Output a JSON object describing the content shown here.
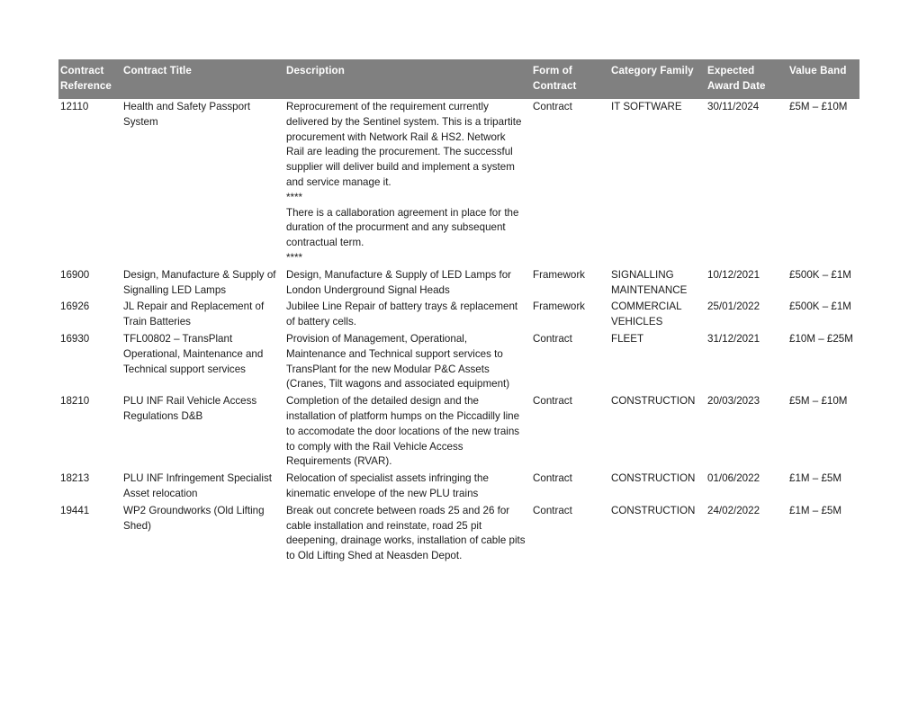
{
  "table": {
    "columns": [
      {
        "key": "contract_reference",
        "label": "Contract Reference"
      },
      {
        "key": "contract_title",
        "label": "Contract Title"
      },
      {
        "key": "description",
        "label": "Description"
      },
      {
        "key": "form_of_contract",
        "label": "Form of Contract"
      },
      {
        "key": "category_family",
        "label": "Category Family"
      },
      {
        "key": "expected_award_date",
        "label": "Expected Award Date"
      },
      {
        "key": "value_band",
        "label": "Value Band"
      }
    ],
    "header_background": "#808080",
    "header_text_color": "#ffffff",
    "rows": [
      {
        "contract_reference": "12110",
        "contract_title": "Health and Safety Passport System",
        "description": "Reprocurement of the requirement currently delivered by the Sentinel system. This is a tripartite procurement with Network Rail & HS2. Network Rail are leading the procurement. The successful supplier will deliver build and implement a system and service manage it.\n****\nThere is a callaboration agreement in place for the duration of the procurment and any subsequent contractual term.\n****",
        "form_of_contract": "Contract",
        "category_family": "IT SOFTWARE",
        "expected_award_date": "30/11/2024",
        "value_band": "£5M – £10M"
      },
      {
        "contract_reference": "16900",
        "contract_title": "Design, Manufacture & Supply of Signalling LED Lamps",
        "description": "Design, Manufacture & Supply of LED Lamps for London Underground Signal Heads",
        "form_of_contract": "Framework",
        "category_family": "SIGNALLING MAINTENANCE",
        "expected_award_date": "10/12/2021",
        "value_band": "£500K – £1M"
      },
      {
        "contract_reference": "16926",
        "contract_title": "JL Repair and Replacement of Train Batteries",
        "description": "Jubilee Line Repair of battery trays & replacement of battery cells.",
        "form_of_contract": "Framework",
        "category_family": "COMMERCIAL VEHICLES",
        "expected_award_date": "25/01/2022",
        "value_band": "£500K – £1M"
      },
      {
        "contract_reference": "16930",
        "contract_title": "TFL00802 – TransPlant Operational, Maintenance and Technical support services",
        "description": "Provision of Management, Operational, Maintenance and Technical support services to TransPlant for the new Modular P&C Assets (Cranes, Tilt wagons and associated equipment)",
        "form_of_contract": "Contract",
        "category_family": "FLEET",
        "expected_award_date": "31/12/2021",
        "value_band": "£10M – £25M"
      },
      {
        "contract_reference": "18210",
        "contract_title": "PLU INF Rail Vehicle Access Regulations D&B",
        "description": "Completion of the detailed design and the installation of platform humps on the Piccadilly line to accomodate the door locations of the new trains to comply with the Rail Vehicle Access Requirements (RVAR).",
        "form_of_contract": "Contract",
        "category_family": "CONSTRUCTION",
        "expected_award_date": "20/03/2023",
        "value_band": "£5M – £10M"
      },
      {
        "contract_reference": "18213",
        "contract_title": "PLU INF Infringement Specialist Asset relocation",
        "description": "Relocation of specialist assets infringing the kinematic envelope of the new PLU trains",
        "form_of_contract": "Contract",
        "category_family": "CONSTRUCTION",
        "expected_award_date": "01/06/2022",
        "value_band": "£1M – £5M"
      },
      {
        "contract_reference": "19441",
        "contract_title": "WP2 Groundworks (Old Lifting Shed)",
        "description": "Break out concrete between roads 25 and 26 for cable installation and reinstate, road 25 pit deepening, drainage works, installation of cable pits to Old Lifting Shed at Neasden Depot.",
        "form_of_contract": "Contract",
        "category_family": "CONSTRUCTION",
        "expected_award_date": "24/02/2022",
        "value_band": "£1M – £5M"
      }
    ]
  }
}
